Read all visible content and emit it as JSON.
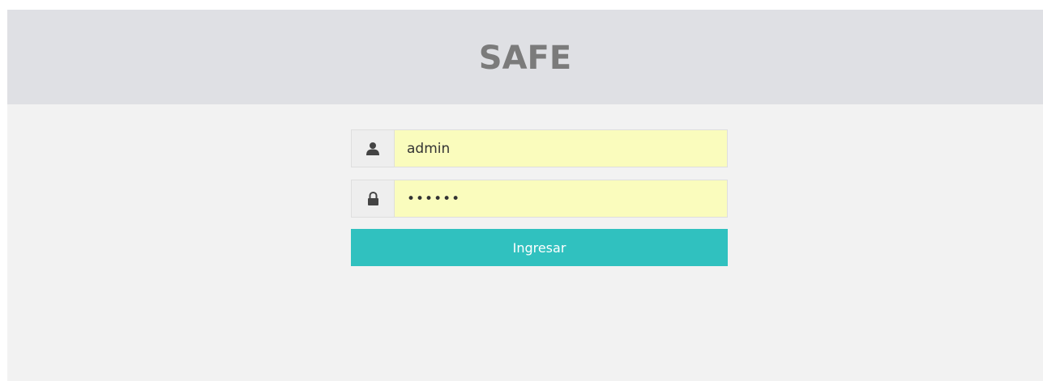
{
  "header": {
    "brand": "SAFE"
  },
  "login": {
    "username": {
      "icon": "user-icon",
      "value": "admin"
    },
    "password": {
      "icon": "lock-icon",
      "value": "••••••"
    },
    "submit_label": "Ingresar"
  },
  "colors": {
    "header_bg": "#dfe0e4",
    "page_bg": "#f2f2f2",
    "autofill_bg": "#fafcbd",
    "accent": "#30c1bf",
    "brand_text": "#7b7b7b"
  }
}
